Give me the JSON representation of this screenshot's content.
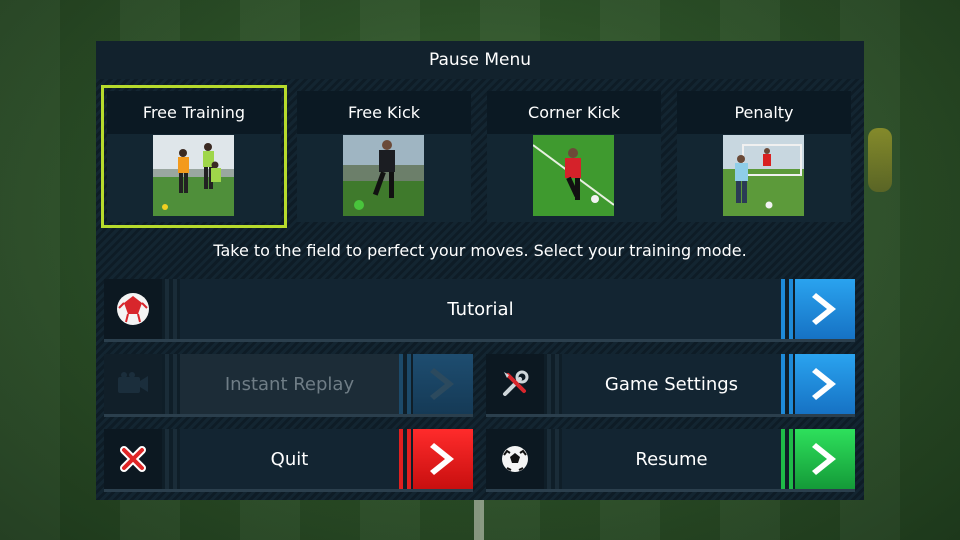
{
  "header": {
    "title": "Pause Menu"
  },
  "modes": [
    {
      "label": "Free Training",
      "selected": true
    },
    {
      "label": "Free Kick",
      "selected": false
    },
    {
      "label": "Corner Kick",
      "selected": false
    },
    {
      "label": "Penalty",
      "selected": false
    }
  ],
  "description": "Take to the field to perfect your moves. Select your training mode.",
  "buttons": {
    "tutorial": {
      "label": "Tutorial",
      "icon": "soccer-ball-icon"
    },
    "instant_replay": {
      "label": "Instant Replay",
      "icon": "camera-icon",
      "disabled": true
    },
    "game_settings": {
      "label": "Game Settings",
      "icon": "wrench-screwdriver-icon"
    },
    "quit": {
      "label": "Quit",
      "icon": "close-x-icon"
    },
    "resume": {
      "label": "Resume",
      "icon": "soccer-ball-icon"
    }
  },
  "colors": {
    "selected_outline": "#b7db2c",
    "arrow_blue": "#1e8ad8",
    "arrow_red": "#e02020",
    "arrow_green": "#1fbb48"
  }
}
